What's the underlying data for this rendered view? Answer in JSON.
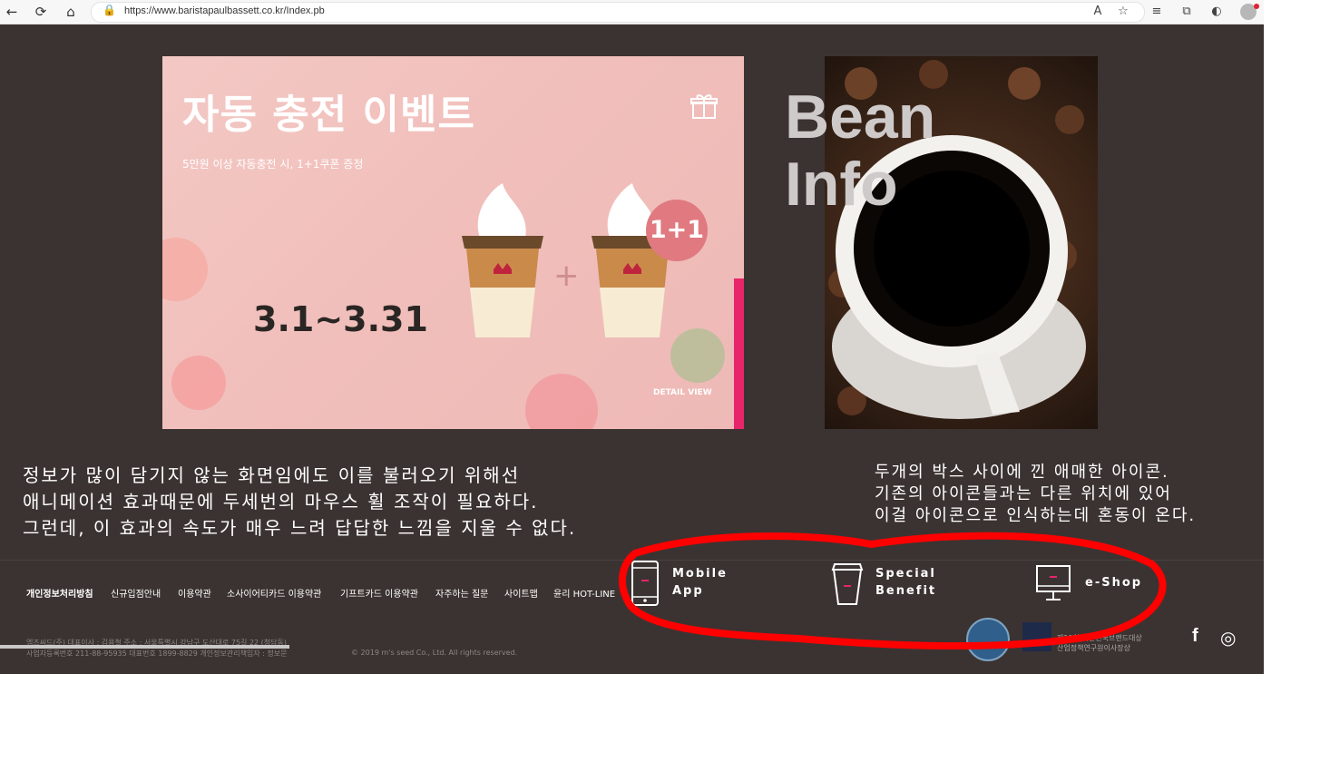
{
  "browser": {
    "url": "https://www.baristapaulbassett.co.kr/Index.pb",
    "back": "←",
    "reload": "⟳",
    "home": "⌂",
    "lock": "🔒",
    "read_aloud": "A",
    "fav": "☆",
    "favorites": "≡",
    "collections": "⧉",
    "edge": "◐"
  },
  "banner": {
    "title": "자동 충전 이벤트",
    "subtitle": "5만원 이상 자동충전 시, 1+1쿠폰 증정",
    "date": "3.1~3.31",
    "badge": "1+1",
    "plus": "+",
    "detail": "DETAIL VIEW"
  },
  "bean": {
    "title_line1": "Bean",
    "title_line2": "Info"
  },
  "notes": {
    "left": "정보가 많이 담기지 않는 화면임에도 이를 불러오기 위해선\n애니메이션 효과때문에 두세번의 마우스 휠 조작이 필요하다.\n그런데, 이 효과의 속도가 매우 느려 답답한 느낌을 지울 수 없다.",
    "right": "두개의 박스 사이에 낀 애매한 아이콘.\n기존의 아이콘들과는 다른 위치에 있어\n이걸 아이콘으로 인식하는데 혼동이 온다."
  },
  "quick_links": [
    {
      "line1": "Mobile",
      "line2": "App"
    },
    {
      "line1": "Special",
      "line2": "Benefit"
    },
    {
      "line1": "e-Shop",
      "line2": ""
    }
  ],
  "footer": {
    "links": [
      "개인정보처리방침",
      "신규입점안내",
      "이용약관",
      "소사이어티카드 이용약관",
      "기프트카드 이용약관",
      "자주하는 질문",
      "사이트맵",
      "윤리 HOT-LINE"
    ],
    "company": "엠즈씨드(주) 대표이사 : 김용철 주소 : 서울특별시 강남구 도산대로 75길 22 (청담동)",
    "registration": "사업자등록번호 211-88-95935 대표번호 1899-8829 개인정보관리책임자 : 정보문",
    "copyright": "© 2019 m's seed Co., Ltd. All rights reserved.",
    "award_line1": "제19회 대한민국브랜드대상",
    "award_line2": "산업정책연구원이사장상",
    "facebook": "f",
    "instagram": "◎"
  },
  "colors": {
    "site_bg": "#3b3331",
    "accent_pink": "#e7256b",
    "annotation_red": "#ff0000"
  }
}
